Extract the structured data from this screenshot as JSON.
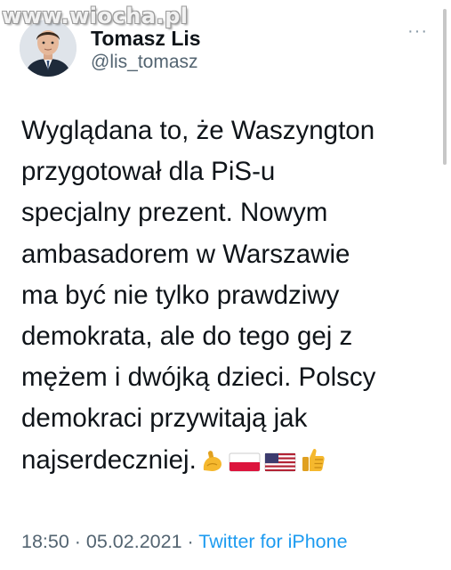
{
  "watermark": "www.wiocha.pl",
  "author": {
    "name": "Tomasz Lis",
    "handle": "@lis_tomasz",
    "avatar_icon": "profile-photo-icon"
  },
  "more_icon": "more-options-icon",
  "tweet": {
    "lines": [
      "Wyglądana to, że Waszyngton",
      "przygotował dla PiS-u",
      "specjalny prezent. Nowym",
      "ambasadorem w Warszawie",
      "ma być nie tylko prawdziwy",
      "demokrata, ale do tego gej z",
      "mężem i dwójką dzieci. Polscy",
      "demokraci przywitają jak",
      "najserdeczniej."
    ],
    "emojis": [
      "flexed-biceps-icon",
      "poland-flag-icon",
      "usa-flag-icon",
      "thumbs-up-icon"
    ]
  },
  "meta": {
    "time": "18:50",
    "separator": " · ",
    "date": "05.02.2021",
    "source": "Twitter for iPhone"
  },
  "colors": {
    "text": "#0f1419",
    "secondary": "#536471",
    "link": "#1d9bf0"
  }
}
